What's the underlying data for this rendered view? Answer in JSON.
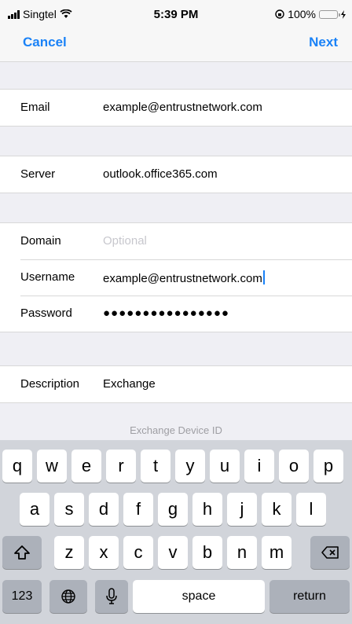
{
  "status_bar": {
    "carrier": "Singtel",
    "time": "5:39 PM",
    "battery": "100%",
    "battery_color": "#f5c518"
  },
  "nav": {
    "cancel": "Cancel",
    "next": "Next",
    "accent_color": "#1a82f7"
  },
  "form": {
    "email": {
      "label": "Email",
      "value": "example@entrustnetwork.com"
    },
    "server": {
      "label": "Server",
      "value": "outlook.office365.com"
    },
    "domain": {
      "label": "Domain",
      "placeholder": "Optional"
    },
    "username": {
      "label": "Username",
      "value": "example@entrustnetwork.com"
    },
    "password": {
      "label": "Password",
      "value": "●●●●●●●●●●●●●●●●"
    },
    "description": {
      "label": "Description",
      "value": "Exchange"
    }
  },
  "footer_text": "Exchange Device ID",
  "keyboard": {
    "row1": [
      "q",
      "w",
      "e",
      "r",
      "t",
      "y",
      "u",
      "i",
      "o",
      "p"
    ],
    "row2": [
      "a",
      "s",
      "d",
      "f",
      "g",
      "h",
      "j",
      "k",
      "l"
    ],
    "row3": [
      "z",
      "x",
      "c",
      "v",
      "b",
      "n",
      "m"
    ],
    "numbers": "123",
    "space": "space",
    "return": "return",
    "icons": [
      "shift-icon",
      "backspace-icon",
      "globe-icon",
      "microphone-icon"
    ]
  }
}
